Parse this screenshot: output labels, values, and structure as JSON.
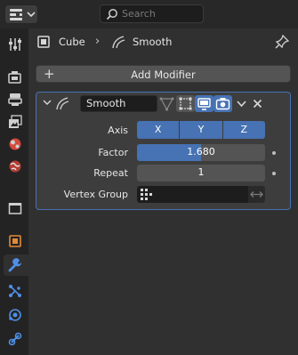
{
  "search": {
    "placeholder": "Search"
  },
  "tabs": [
    {
      "icon": "tool-icon"
    },
    {
      "icon": "render-icon"
    },
    {
      "icon": "output-icon"
    },
    {
      "icon": "view-layer-icon"
    },
    {
      "icon": "scene-icon"
    },
    {
      "icon": "world-icon"
    },
    {
      "icon": "collection-icon"
    },
    {
      "icon": "object-icon"
    },
    {
      "icon": "modifier-wrench-icon",
      "active": true
    },
    {
      "icon": "particles-icon"
    },
    {
      "icon": "physics-icon"
    },
    {
      "icon": "constraints-icon"
    }
  ],
  "breadcrumb": {
    "object": "Cube",
    "separator": "›",
    "modifier": "Smooth"
  },
  "add_modifier": {
    "plus": "+",
    "label": "Add Modifier"
  },
  "modifier": {
    "name": "Smooth",
    "toggles": {
      "on_cage": false,
      "edit_mode": false,
      "realtime": true,
      "render": true
    },
    "axis_label": "Axis",
    "axes": [
      "X",
      "Y",
      "Z"
    ],
    "factor_label": "Factor",
    "factor_value": "1.680",
    "factor_fill": 0.5,
    "repeat_label": "Repeat",
    "repeat_value": "1",
    "vertex_group_label": "Vertex Group",
    "vertex_group_value": ""
  },
  "colors": {
    "accent": "#4772b3",
    "panel_bg": "#3d3d3d",
    "field_bg": "#545454",
    "window_bg": "#303030"
  }
}
